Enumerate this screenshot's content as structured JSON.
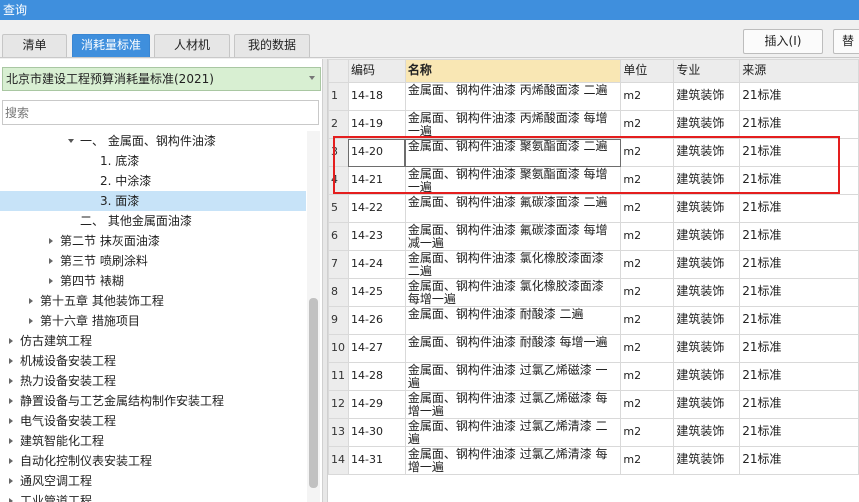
{
  "window": {
    "title": "查询"
  },
  "tabs": [
    {
      "label": "清单",
      "active": false
    },
    {
      "label": "消耗量标准",
      "active": true
    },
    {
      "label": "人材机",
      "active": false
    },
    {
      "label": "我的数据",
      "active": false
    }
  ],
  "toolbar": {
    "insert_label": "插入(I)",
    "next_label": "替"
  },
  "left_panel": {
    "standard_select_value": "北京市建设工程预算消耗量标准(2021)",
    "search_placeholder": "搜索",
    "tree": [
      {
        "label": "一、 金属面、钢构件油漆",
        "level": 3,
        "toggle": "expanded"
      },
      {
        "label": "1. 底漆",
        "level": 4,
        "toggle": "none"
      },
      {
        "label": "2. 中涂漆",
        "level": 4,
        "toggle": "none"
      },
      {
        "label": "3. 面漆",
        "level": 4,
        "toggle": "none",
        "selected": true
      },
      {
        "label": "二、 其他金属面油漆",
        "level": 3,
        "toggle": "none"
      },
      {
        "label": "第二节 抹灰面油漆",
        "level": 2,
        "toggle": "collapsed"
      },
      {
        "label": "第三节 喷刷涂料",
        "level": 2,
        "toggle": "collapsed"
      },
      {
        "label": "第四节 裱糊",
        "level": 2,
        "toggle": "collapsed"
      },
      {
        "label": "第十五章 其他装饰工程",
        "level": 1,
        "toggle": "collapsed"
      },
      {
        "label": "第十六章 措施项目",
        "level": 1,
        "toggle": "collapsed"
      },
      {
        "label": "仿古建筑工程",
        "level": 0,
        "toggle": "collapsed"
      },
      {
        "label": "机械设备安装工程",
        "level": 0,
        "toggle": "collapsed"
      },
      {
        "label": "热力设备安装工程",
        "level": 0,
        "toggle": "collapsed"
      },
      {
        "label": "静置设备与工艺金属结构制作安装工程",
        "level": 0,
        "toggle": "collapsed"
      },
      {
        "label": "电气设备安装工程",
        "level": 0,
        "toggle": "collapsed"
      },
      {
        "label": "建筑智能化工程",
        "level": 0,
        "toggle": "collapsed"
      },
      {
        "label": "自动化控制仪表安装工程",
        "level": 0,
        "toggle": "collapsed"
      },
      {
        "label": "通风空调工程",
        "level": 0,
        "toggle": "collapsed"
      },
      {
        "label": "工业管道工程",
        "level": 0,
        "toggle": "collapsed"
      }
    ]
  },
  "table": {
    "columns": [
      "",
      "编码",
      "名称",
      "单位",
      "专业",
      "来源"
    ],
    "rows": [
      {
        "idx": "1",
        "code": "14-18",
        "name": "金属面、钢构件油漆 丙烯酸面漆 二遍",
        "unit": "m2",
        "category": "建筑装饰",
        "source": "21标准"
      },
      {
        "idx": "2",
        "code": "14-19",
        "name": "金属面、钢构件油漆 丙烯酸面漆 每增一遍",
        "unit": "m2",
        "category": "建筑装饰",
        "source": "21标准"
      },
      {
        "idx": "3",
        "code": "14-20",
        "name": "金属面、钢构件油漆 聚氨酯面漆 二遍",
        "unit": "m2",
        "category": "建筑装饰",
        "source": "21标准",
        "focus": true
      },
      {
        "idx": "4",
        "code": "14-21",
        "name": "金属面、钢构件油漆 聚氨酯面漆 每增一遍",
        "unit": "m2",
        "category": "建筑装饰",
        "source": "21标准"
      },
      {
        "idx": "5",
        "code": "14-22",
        "name": "金属面、钢构件油漆 氟碳漆面漆 二遍",
        "unit": "m2",
        "category": "建筑装饰",
        "source": "21标准"
      },
      {
        "idx": "6",
        "code": "14-23",
        "name": "金属面、钢构件油漆 氟碳漆面漆 每增减一遍",
        "unit": "m2",
        "category": "建筑装饰",
        "source": "21标准"
      },
      {
        "idx": "7",
        "code": "14-24",
        "name": "金属面、钢构件油漆 氯化橡胶漆面漆 二遍",
        "unit": "m2",
        "category": "建筑装饰",
        "source": "21标准"
      },
      {
        "idx": "8",
        "code": "14-25",
        "name": "金属面、钢构件油漆 氯化橡胶漆面漆 每增一遍",
        "unit": "m2",
        "category": "建筑装饰",
        "source": "21标准"
      },
      {
        "idx": "9",
        "code": "14-26",
        "name": "金属面、钢构件油漆 耐酸漆 二遍",
        "unit": "m2",
        "category": "建筑装饰",
        "source": "21标准"
      },
      {
        "idx": "10",
        "code": "14-27",
        "name": "金属面、钢构件油漆 耐酸漆 每增一遍",
        "unit": "m2",
        "category": "建筑装饰",
        "source": "21标准"
      },
      {
        "idx": "11",
        "code": "14-28",
        "name": "金属面、钢构件油漆 过氯乙烯磁漆 一遍",
        "unit": "m2",
        "category": "建筑装饰",
        "source": "21标准"
      },
      {
        "idx": "12",
        "code": "14-29",
        "name": "金属面、钢构件油漆 过氯乙烯磁漆 每增一遍",
        "unit": "m2",
        "category": "建筑装饰",
        "source": "21标准"
      },
      {
        "idx": "13",
        "code": "14-30",
        "name": "金属面、钢构件油漆 过氯乙烯清漆 二遍",
        "unit": "m2",
        "category": "建筑装饰",
        "source": "21标准"
      },
      {
        "idx": "14",
        "code": "14-31",
        "name": "金属面、钢构件油漆 过氯乙烯清漆 每增一遍",
        "unit": "m2",
        "category": "建筑装饰",
        "source": "21标准"
      }
    ]
  }
}
